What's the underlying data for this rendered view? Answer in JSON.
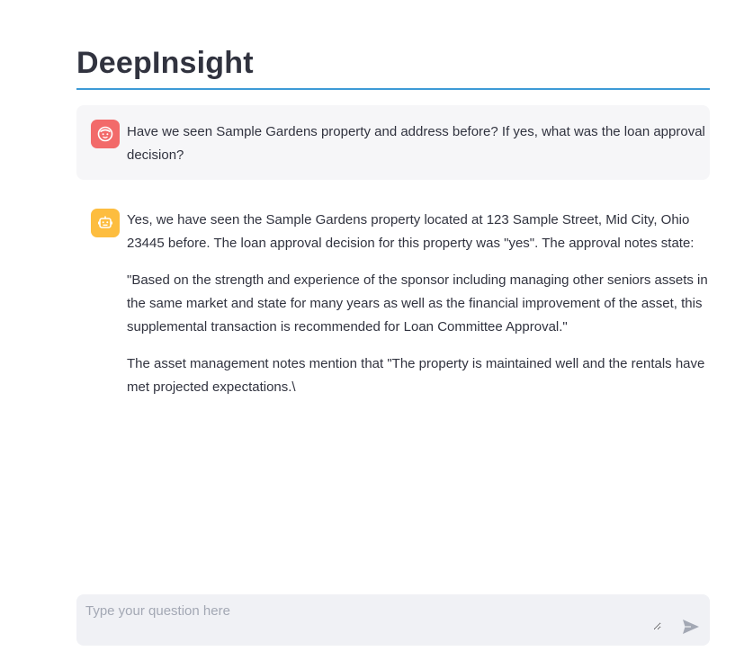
{
  "app": {
    "title": "DeepInsight"
  },
  "messages": [
    {
      "role": "user",
      "avatar_icon": "user-face-icon",
      "paragraphs": [
        "Have we seen Sample Gardens property and address before? If yes, what was the loan approval decision?"
      ]
    },
    {
      "role": "assistant",
      "avatar_icon": "robot-icon",
      "paragraphs": [
        "Yes, we have seen the Sample Gardens property located at 123 Sample Street, Mid City, Ohio 23445 before. The loan approval decision for this property was \"yes\". The approval notes state:",
        "\"Based on the strength and experience of the sponsor including managing other seniors assets in the same market and state for many years as well as the financial improvement of the asset, this supplemental transaction is recommended for Loan Committee Approval.\"",
        "The asset management notes mention that \"The property is maintained well and the rentals have met projected expectations.\\"
      ]
    }
  ],
  "chat_input": {
    "placeholder": "Type your question here",
    "value": "",
    "send_icon": "send-icon"
  },
  "colors": {
    "accent_rule": "#3d9ad6",
    "user_avatar": "#f26a6a",
    "assistant_avatar": "#fdbd3f",
    "user_bubble": "#f6f6f8",
    "input_bg": "#f0f1f5"
  }
}
